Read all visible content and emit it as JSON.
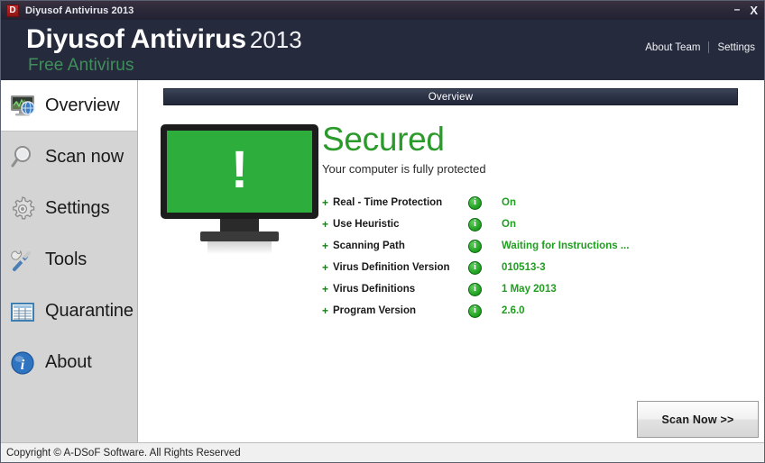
{
  "window": {
    "logo_letter": "D",
    "title": "Diyusof Antivirus 2013",
    "minimize": "–",
    "close": "X"
  },
  "header": {
    "brand_main": "Diyusof Antivirus",
    "brand_year": "2013",
    "subtitle": "Free Antivirus",
    "links": [
      {
        "label": "About Team"
      },
      {
        "label": "Settings"
      }
    ]
  },
  "sidebar": {
    "items": [
      {
        "label": "Overview",
        "icon": "monitor-globe-icon",
        "active": true
      },
      {
        "label": "Scan now",
        "icon": "magnifier-icon",
        "active": false
      },
      {
        "label": "Settings",
        "icon": "gear-icon",
        "active": false
      },
      {
        "label": "Tools",
        "icon": "tools-icon",
        "active": false
      },
      {
        "label": "Quarantine",
        "icon": "table-list-icon",
        "active": false
      },
      {
        "label": "About",
        "icon": "info-circle-icon",
        "active": false
      }
    ]
  },
  "main": {
    "section_title": "Overview",
    "graphic": {
      "icon": "monitor-secured-icon",
      "mark": "!",
      "screen_color": "#2dad3c"
    },
    "status_title": "Secured",
    "status_subtitle": "Your computer is fully protected",
    "status_color": "#2a9a2a",
    "rows": [
      {
        "prefix": "+",
        "label": "Real - Time Protection",
        "badge": "i",
        "value": "On"
      },
      {
        "prefix": "+",
        "label": "Use Heuristic",
        "badge": "i",
        "value": "On"
      },
      {
        "prefix": "+",
        "label": "Scanning Path",
        "badge": "i",
        "value": "Waiting for Instructions ..."
      },
      {
        "prefix": "+",
        "label": "Virus Definition Version",
        "badge": "i",
        "value": "010513-3"
      },
      {
        "prefix": "+",
        "label": "Virus Definitions",
        "badge": "i",
        "value": "1 May 2013"
      },
      {
        "prefix": "+",
        "label": "Program Version",
        "badge": "i",
        "value": "2.6.0"
      }
    ],
    "scan_button": "Scan Now  >>"
  },
  "footer": {
    "copyright": "Copyright © A-DSoF Software. All Rights Reserved"
  }
}
